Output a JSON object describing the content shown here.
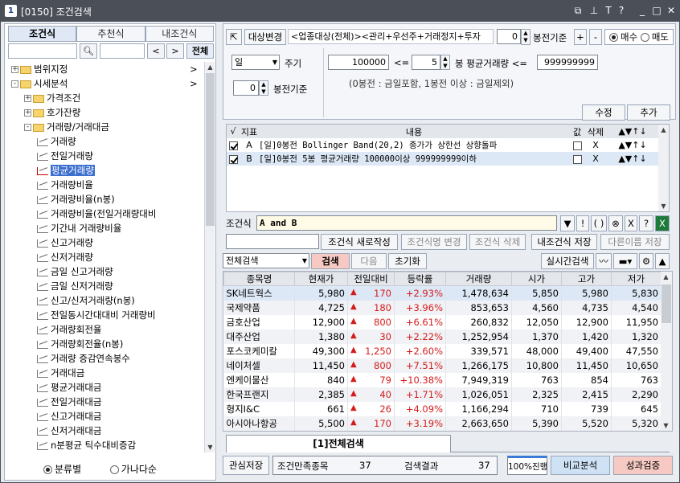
{
  "window": {
    "number": "1",
    "title": "[0150] 조건검색"
  },
  "left": {
    "tabs": [
      "조건식",
      "추천식",
      "내조건식"
    ],
    "search_btn_all": "전체",
    "tree": [
      {
        "label": "범위지정",
        "level": 0,
        "type": "folder",
        "expander": "+",
        "arrow": ">"
      },
      {
        "label": "시세분석",
        "level": 0,
        "type": "folder",
        "expander": "-",
        "arrow": ">"
      },
      {
        "label": "가격조건",
        "level": 1,
        "type": "folder",
        "expander": "+"
      },
      {
        "label": "호가잔량",
        "level": 1,
        "type": "folder",
        "expander": "+"
      },
      {
        "label": "거래량/거래대금",
        "level": 1,
        "type": "folder",
        "expander": "-"
      },
      {
        "label": "거래량",
        "level": 2,
        "type": "item"
      },
      {
        "label": "전일거래량",
        "level": 2,
        "type": "item"
      },
      {
        "label": "평균거래량",
        "level": 2,
        "type": "item",
        "selected": true
      },
      {
        "label": "거래량비율",
        "level": 2,
        "type": "item"
      },
      {
        "label": "거래량비율(n봉)",
        "level": 2,
        "type": "item"
      },
      {
        "label": "거래량비율(전일거래량대비",
        "level": 2,
        "type": "item"
      },
      {
        "label": "기간내 거래량비율",
        "level": 2,
        "type": "item"
      },
      {
        "label": "신고거래량",
        "level": 2,
        "type": "item"
      },
      {
        "label": "신저거래량",
        "level": 2,
        "type": "item"
      },
      {
        "label": "금일 신고거래량",
        "level": 2,
        "type": "item"
      },
      {
        "label": "금일 신저거래량",
        "level": 2,
        "type": "item"
      },
      {
        "label": "신고/신저거래량(n봉)",
        "level": 2,
        "type": "item"
      },
      {
        "label": "전일동시간대대비 거래량비",
        "level": 2,
        "type": "item"
      },
      {
        "label": "거래량회전율",
        "level": 2,
        "type": "item"
      },
      {
        "label": "거래량회전율(n봉)",
        "level": 2,
        "type": "item"
      },
      {
        "label": "거래량 증감연속봉수",
        "level": 2,
        "type": "item"
      },
      {
        "label": "거래대금",
        "level": 2,
        "type": "item"
      },
      {
        "label": "평균거래대금",
        "level": 2,
        "type": "item"
      },
      {
        "label": "전일거래대금",
        "level": 2,
        "type": "item"
      },
      {
        "label": "신고거래대금",
        "level": 2,
        "type": "item"
      },
      {
        "label": "신저거래대금",
        "level": 2,
        "type": "item"
      },
      {
        "label": "n분평균 틱수대비증감",
        "level": 2,
        "type": "item"
      }
    ],
    "radio1": "분류별",
    "radio2": "가나다순"
  },
  "cond": {
    "target_btn": "대상변경",
    "target_text": "<업종대상(전체)><관리+우선주+거래정지+투자",
    "bong_val": "0",
    "bong_label": "봉전기준",
    "plus": "+",
    "minus": "-",
    "buy": "매수",
    "sell": "매도",
    "period": "일",
    "period_label": "주기",
    "bong2_val": "0",
    "bong2_label": "봉전기준",
    "min_val": "100000",
    "lte1": "<=",
    "n_val": "5",
    "mid_label": "봉 평균거래량 <=",
    "max_val": "999999999",
    "note": "(0봉전 : 금일포함, 1봉전 이상 : 금일제외)",
    "edit_btn": "수정",
    "add_btn": "추가"
  },
  "ind": {
    "headers": {
      "check": "√",
      "idx": "지표",
      "content": "내용",
      "val": "값",
      "del": "삭제",
      "arrows": "▲▼↑↓"
    },
    "rows": [
      {
        "idx": "A",
        "content": "[일]0봉전 Bollinger Band(20,2) 종가가 상한선 상향돌파",
        "del": "X",
        "arrows": "▲▼↑↓"
      },
      {
        "idx": "B",
        "content": "[일]0봉전 5봉 평균거래량 100000이상 999999999이하",
        "del": "X",
        "arrows": "▲▼↑↓"
      }
    ]
  },
  "formula": {
    "label": "조건식",
    "value": "A and B",
    "tools": [
      "▼",
      "!",
      "( )",
      "⊗",
      "X",
      "?"
    ]
  },
  "actions": {
    "save_new": "조건식 새로작성",
    "rename": "조건식명 변경",
    "delete": "조건식 삭제",
    "my_save": "내조건식 저장",
    "save_as": "다른이름 저장"
  },
  "search": {
    "select": "전체검색",
    "search_btn": "검색",
    "next_btn": "다음",
    "reset_btn": "초기화",
    "realtime_btn": "실시간검색"
  },
  "results": {
    "headers": [
      "종목명",
      "현재가",
      "전일대비",
      "등락률",
      "거래량",
      "시가",
      "고가",
      "저가"
    ],
    "rows": [
      {
        "name": "SK네트웍스",
        "price": "5,980",
        "chg": "170",
        "rate": "+2.93%",
        "vol": "1,478,634",
        "open": "5,850",
        "high": "5,980",
        "low": "5,830"
      },
      {
        "name": "국제약품",
        "price": "4,725",
        "chg": "180",
        "rate": "+3.96%",
        "vol": "853,653",
        "open": "4,560",
        "high": "4,735",
        "low": "4,540"
      },
      {
        "name": "금호산업",
        "price": "12,900",
        "chg": "800",
        "rate": "+6.61%",
        "vol": "260,832",
        "open": "12,050",
        "high": "12,900",
        "low": "11,950"
      },
      {
        "name": "대주산업",
        "price": "1,380",
        "chg": "30",
        "rate": "+2.22%",
        "vol": "1,252,954",
        "open": "1,370",
        "high": "1,420",
        "low": "1,320"
      },
      {
        "name": "포스코케미칼",
        "price": "49,300",
        "chg": "1,250",
        "rate": "+2.60%",
        "vol": "339,571",
        "open": "48,000",
        "high": "49,400",
        "low": "47,550"
      },
      {
        "name": "네이처셀",
        "price": "11,450",
        "chg": "800",
        "rate": "+7.51%",
        "vol": "1,266,175",
        "open": "10,800",
        "high": "11,450",
        "low": "10,650"
      },
      {
        "name": "엔케이물산",
        "price": "840",
        "chg": "79",
        "rate": "+10.38%",
        "vol": "7,949,319",
        "open": "763",
        "high": "854",
        "low": "763"
      },
      {
        "name": "한국프랜지",
        "price": "2,385",
        "chg": "40",
        "rate": "+1.71%",
        "vol": "1,026,051",
        "open": "2,325",
        "high": "2,415",
        "low": "2,290"
      },
      {
        "name": "형지I&C",
        "price": "661",
        "chg": "26",
        "rate": "+4.09%",
        "vol": "1,166,294",
        "open": "710",
        "high": "739",
        "low": "645"
      },
      {
        "name": "아시아나항공",
        "price": "5,500",
        "chg": "170",
        "rate": "+3.19%",
        "vol": "2,663,650",
        "open": "5,390",
        "high": "5,520",
        "low": "5,320"
      }
    ]
  },
  "bottom": {
    "tab": "[1]전체검색",
    "save_btn": "관심저장",
    "match_label": "조건만족종목",
    "match_val": "37",
    "result_label": "검색결과",
    "result_val": "37",
    "progress": "100%진행",
    "compare_btn": "비교분석",
    "perf_btn": "성과검증"
  }
}
